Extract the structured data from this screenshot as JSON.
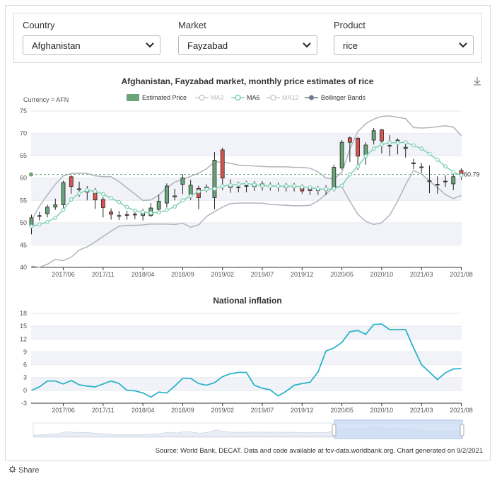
{
  "filters": {
    "country": {
      "label": "Country",
      "value": "Afghanistan"
    },
    "market": {
      "label": "Market",
      "value": "Fayzabad"
    },
    "product": {
      "label": "Product",
      "value": "rice"
    }
  },
  "price_chart": {
    "title": "Afghanistan, Fayzabad market, monthly price estimates of rice",
    "currency": "Currency = AFN",
    "legend": [
      "Estimated Price",
      "MA3",
      "MA6",
      "MA12",
      "Bollinger Bands"
    ],
    "last_label": "60.79"
  },
  "inflation_chart": {
    "title": "National inflation"
  },
  "footer": {
    "source": "Source: World Bank, DECAT. Data and code available at fcv-data.worldbank.org. Chart generated on 9/2/2021"
  },
  "share_label": "Share",
  "colors": {
    "up": "#6aa57a",
    "down": "#d9544f",
    "ma6": "#7fd0b4",
    "band": "#b0b4bb",
    "inflation": "#2bb3c9",
    "grid_band": "#f1f3f8"
  },
  "icons": {
    "download": "download-icon",
    "share": "gear-icon",
    "chevron": "chevron-down-icon"
  },
  "chart_data": [
    {
      "type": "candlestick",
      "title": "Afghanistan, Fayzabad market, monthly price estimates of rice",
      "ylabel": "Currency = AFN",
      "ylim": [
        40,
        75
      ],
      "yticks": [
        40,
        45,
        50,
        55,
        60,
        65,
        70,
        75
      ],
      "xtick_labels": [
        "2017/06",
        "2017/11",
        "2018/04",
        "2018/09",
        "2019/02",
        "2019/07",
        "2019/12",
        "2020/05",
        "2020/10",
        "2021/03",
        "2021/08"
      ],
      "x": [
        "2017/02",
        "2017/03",
        "2017/04",
        "2017/05",
        "2017/06",
        "2017/07",
        "2017/08",
        "2017/09",
        "2017/10",
        "2017/11",
        "2017/12",
        "2018/01",
        "2018/02",
        "2018/03",
        "2018/04",
        "2018/05",
        "2018/06",
        "2018/07",
        "2018/08",
        "2018/09",
        "2018/10",
        "2018/11",
        "2018/12",
        "2019/01",
        "2019/02",
        "2019/03",
        "2019/04",
        "2019/05",
        "2019/06",
        "2019/07",
        "2019/08",
        "2019/09",
        "2019/10",
        "2019/11",
        "2019/12",
        "2020/01",
        "2020/02",
        "2020/03",
        "2020/04",
        "2020/05",
        "2020/06",
        "2020/07",
        "2020/08",
        "2020/09",
        "2020/10",
        "2020/11",
        "2020/12",
        "2021/01",
        "2021/02",
        "2021/03",
        "2021/04",
        "2021/05",
        "2021/06",
        "2021/07",
        "2021/08"
      ],
      "open": [
        49.2,
        51.4,
        52.0,
        53.5,
        54.0,
        60.3,
        57.4,
        57.0,
        56.6,
        55.2,
        52.4,
        51.6,
        51.8,
        51.9,
        51.6,
        51.6,
        53.0,
        54.4,
        55.8,
        58.6,
        56.2,
        57.7,
        57.8,
        55.6,
        66.3,
        58.5,
        57.9,
        58.3,
        58.1,
        58.7,
        58.4,
        58.2,
        58.2,
        58.0,
        58.1,
        57.6,
        57.2,
        57.3,
        57.6,
        62.3,
        69.0,
        68.9,
        65.0,
        68.5,
        70.8,
        67.3,
        68.5,
        66.6,
        63.4,
        62.5,
        59.2,
        58.6,
        59.3,
        58.7,
        61.7
      ],
      "close": [
        51.1,
        51.6,
        53.5,
        54.0,
        59.0,
        58.1,
        57.6,
        57.0,
        55.1,
        53.4,
        51.9,
        51.6,
        51.7,
        51.8,
        52.2,
        53.3,
        54.8,
        58.2,
        56.0,
        60.0,
        58.4,
        55.6,
        58.0,
        64.0,
        60.0,
        57.9,
        58.0,
        58.2,
        58.7,
        58.1,
        58.2,
        58.2,
        57.9,
        58.1,
        57.1,
        57.2,
        57.4,
        57.4,
        62.4,
        68.0,
        68.0,
        64.9,
        67.4,
        70.6,
        68.3,
        67.3,
        68.5,
        66.9,
        63.2,
        62.5,
        59.4,
        58.5,
        59.2,
        60.3,
        60.8
      ],
      "high": [
        51.8,
        52.4,
        54.0,
        55.4,
        59.4,
        60.6,
        59.2,
        58.2,
        57.8,
        55.7,
        53.2,
        52.6,
        52.7,
        52.7,
        53.1,
        54.4,
        56.3,
        58.8,
        57.6,
        60.9,
        59.6,
        58.3,
        58.6,
        65.8,
        66.8,
        59.7,
        59.2,
        59.4,
        59.3,
        59.3,
        59.0,
        59.0,
        58.9,
        58.9,
        58.6,
        58.2,
        58.2,
        58.4,
        63.0,
        68.5,
        69.3,
        69.2,
        68.0,
        71.2,
        71.0,
        69.6,
        68.9,
        68.0,
        64.3,
        63.4,
        62.8,
        60.4,
        60.6,
        61.7,
        62.2
      ],
      "low": [
        47.4,
        50.5,
        51.2,
        52.9,
        53.1,
        56.5,
        55.8,
        55.0,
        53.1,
        51.2,
        50.7,
        50.6,
        50.7,
        50.8,
        50.5,
        51.3,
        52.4,
        53.4,
        55.0,
        56.4,
        55.1,
        53.0,
        56.8,
        53.0,
        57.3,
        56.7,
        56.8,
        56.8,
        57.1,
        57.2,
        57.2,
        57.0,
        57.0,
        57.0,
        56.5,
        56.2,
        56.2,
        56.2,
        57.0,
        61.9,
        63.6,
        61.8,
        63.0,
        67.5,
        65.5,
        64.9,
        65.3,
        64.6,
        62.0,
        61.2,
        56.6,
        56.5,
        58.0,
        57.3,
        59.6
      ],
      "ma6": [
        49.2,
        49.6,
        50.2,
        51.1,
        52.9,
        55.2,
        56.6,
        57.3,
        57.0,
        56.4,
        55.5,
        54.6,
        53.5,
        52.7,
        52.4,
        52.2,
        52.3,
        52.8,
        53.6,
        55.0,
        56.0,
        57.0,
        57.5,
        57.6,
        58.2,
        58.4,
        58.6,
        58.8,
        58.5,
        58.3,
        58.2,
        58.2,
        58.2,
        58.2,
        58.0,
        57.9,
        57.6,
        57.5,
        57.6,
        58.3,
        60.8,
        62.6,
        64.9,
        66.6,
        67.5,
        67.9,
        67.9,
        68.0,
        67.3,
        66.6,
        65.4,
        64.1,
        62.6,
        61.3,
        60.6
      ],
      "bollinger_upper": [
        50.5,
        53.7,
        56.2,
        58.6,
        60.5,
        61.0,
        61.1,
        61.0,
        60.5,
        60.3,
        60.3,
        59.2,
        57.8,
        56.4,
        55.0,
        55.1,
        56.2,
        57.8,
        59.1,
        59.7,
        60.4,
        61.1,
        62.1,
        63.6,
        63.6,
        63.3,
        62.9,
        62.8,
        62.7,
        62.6,
        62.5,
        62.5,
        62.5,
        62.4,
        62.4,
        62.2,
        61.4,
        60.0,
        59.8,
        61.3,
        66.5,
        70.4,
        72.2,
        73.2,
        73.8,
        73.9,
        73.6,
        73.3,
        71.3,
        71.2,
        71.3,
        71.5,
        71.7,
        71.4,
        69.5
      ],
      "bollinger_lower": [
        40.3,
        40.0,
        40.7,
        41.8,
        41.5,
        42.3,
        43.9,
        44.6,
        45.7,
        46.9,
        48.1,
        49.2,
        49.4,
        49.4,
        49.5,
        49.7,
        49.7,
        49.7,
        49.6,
        49.9,
        49.0,
        49.5,
        51.4,
        52.5,
        53.5,
        54.3,
        54.4,
        54.4,
        54.4,
        54.4,
        54.1,
        54.0,
        53.9,
        53.8,
        53.8,
        53.9,
        54.9,
        56.4,
        58.1,
        58.0,
        54.8,
        51.9,
        50.3,
        49.6,
        50.0,
        51.7,
        54.8,
        58.5,
        61.7,
        60.9,
        59.3,
        57.9,
        56.3,
        55.4,
        56.1
      ]
    },
    {
      "type": "line",
      "title": "National inflation",
      "ylim": [
        -3,
        18
      ],
      "yticks": [
        -3,
        0,
        3,
        6,
        9,
        12,
        15,
        18
      ],
      "xtick_labels": [
        "2017/06",
        "2017/11",
        "2018/04",
        "2018/09",
        "2019/02",
        "2019/07",
        "2019/12",
        "2020/05",
        "2020/10",
        "2021/03",
        "2021/08"
      ],
      "x": [
        "2017/02",
        "2017/03",
        "2017/04",
        "2017/05",
        "2017/06",
        "2017/07",
        "2017/08",
        "2017/09",
        "2017/10",
        "2017/11",
        "2017/12",
        "2018/01",
        "2018/02",
        "2018/03",
        "2018/04",
        "2018/05",
        "2018/06",
        "2018/07",
        "2018/08",
        "2018/09",
        "2018/10",
        "2018/11",
        "2018/12",
        "2019/01",
        "2019/02",
        "2019/03",
        "2019/04",
        "2019/05",
        "2019/06",
        "2019/07",
        "2019/08",
        "2019/09",
        "2019/10",
        "2019/11",
        "2019/12",
        "2020/01",
        "2020/02",
        "2020/03",
        "2020/04",
        "2020/05",
        "2020/06",
        "2020/07",
        "2020/08",
        "2020/09",
        "2020/10",
        "2020/11",
        "2020/12",
        "2021/01",
        "2021/02",
        "2021/03",
        "2021/04",
        "2021/05",
        "2021/06",
        "2021/07",
        "2021/08"
      ],
      "values": [
        0.0,
        0.8,
        2.2,
        2.2,
        1.5,
        2.3,
        1.3,
        1.0,
        0.8,
        1.5,
        2.2,
        1.6,
        0.0,
        -0.1,
        -0.6,
        -1.6,
        -0.4,
        -0.6,
        1.0,
        2.8,
        2.8,
        1.6,
        1.2,
        1.8,
        3.2,
        3.9,
        4.2,
        4.2,
        1.2,
        0.5,
        0.1,
        -1.3,
        -0.2,
        1.2,
        1.6,
        1.9,
        4.3,
        9.2,
        9.9,
        11.2,
        13.7,
        14.0,
        13.1,
        15.4,
        15.5,
        14.2,
        14.2,
        14.2,
        10.0,
        6.0,
        4.3,
        2.5,
        4.1,
        5.0,
        5.1
      ]
    }
  ]
}
